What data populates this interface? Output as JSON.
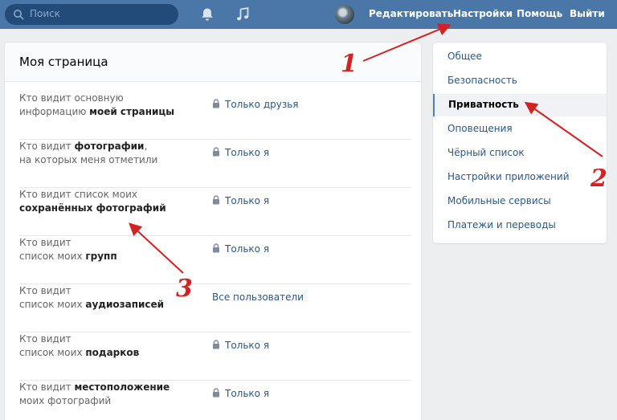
{
  "header": {
    "search_placeholder": "Поиск",
    "links": {
      "edit": "Редактировать",
      "settings": "Настройки",
      "help": "Помощь",
      "logout": "Выйти"
    }
  },
  "main": {
    "title": "Моя страница",
    "rows": [
      {
        "line1": "Кто видит основную",
        "line2_pre": "информацию ",
        "line2_bold": "моей страницы",
        "value": "Только друзья"
      },
      {
        "line1_pre": "Кто видит ",
        "line1_bold": "фотографии",
        "line1_post": ",",
        "line2": "на которых меня отметили",
        "value": "Только я"
      },
      {
        "line1": "Кто видит список моих",
        "line2_bold": "сохранённых фотографий",
        "value": "Только я"
      },
      {
        "line1": "Кто видит",
        "line2_pre": "список моих ",
        "line2_bold": "групп",
        "value": "Только я"
      },
      {
        "line1": "Кто видит",
        "line2_pre": "список моих ",
        "line2_bold": "аудиозаписей",
        "value": "Все пользователи"
      },
      {
        "line1": "Кто видит",
        "line2_pre": "список моих ",
        "line2_bold": "подарков",
        "value": "Только я"
      },
      {
        "line1_pre": "Кто видит ",
        "line1_bold": "местоположение",
        "line2": "моих фотографий",
        "value": "Только я"
      }
    ]
  },
  "sidebar": {
    "items": [
      {
        "label": "Общее"
      },
      {
        "label": "Безопасность"
      },
      {
        "label": "Приватность"
      },
      {
        "label": "Оповещения"
      },
      {
        "label": "Чёрный список"
      },
      {
        "label": "Настройки приложений"
      },
      {
        "label": "Мобильные сервисы"
      },
      {
        "label": "Платежи и переводы"
      }
    ],
    "active_index": 2
  },
  "annotations": {
    "n1": "1",
    "n2": "2",
    "n3": "3"
  },
  "colors": {
    "topbar": "#4a76a8",
    "accent": "#5181b8",
    "annotation": "#d42222"
  }
}
